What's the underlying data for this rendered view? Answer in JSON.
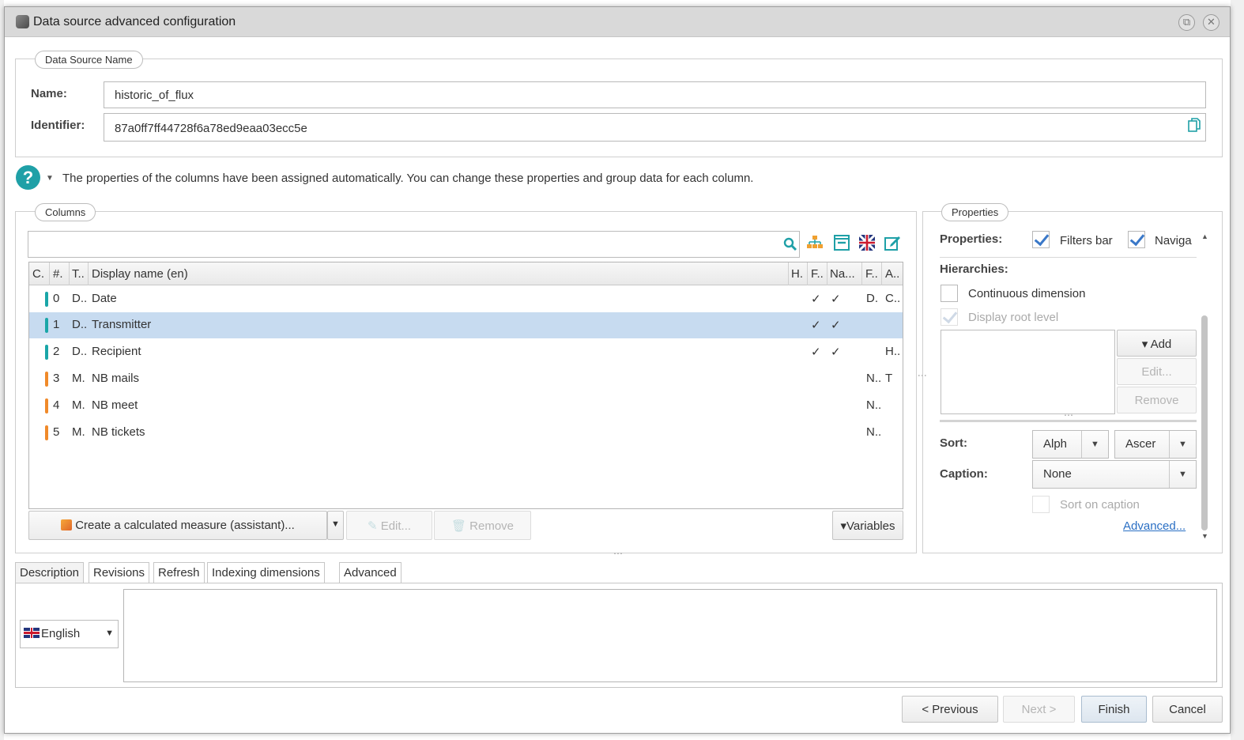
{
  "dialog": {
    "title": "Data source advanced configuration",
    "maximize_glyph": "⧉",
    "close_glyph": "✕"
  },
  "datasource": {
    "legend": "Data Source Name",
    "name_label": "Name:",
    "name_value": "historic_of_flux",
    "identifier_label": "Identifier:",
    "identifier_value": "87a0ff7ff44728f6a78ed9eaa03ecc5e"
  },
  "info": {
    "help_glyph": "?",
    "caret": "▼",
    "text": "The properties of the columns have been assigned automatically. You can change these properties and group data for each column."
  },
  "columns": {
    "legend": "Columns",
    "search_placeholder": "",
    "headers": [
      "C.",
      "#.",
      "T..",
      "Display name (en)",
      "H.",
      "F..",
      "Na...",
      "F..",
      "A.."
    ],
    "rows": [
      {
        "num": "0",
        "type": "D..",
        "name": "Date",
        "f": "✓",
        "na": "✓",
        "f2": "D.",
        "a": "C..",
        "bar_color": "#1aa6a8"
      },
      {
        "num": "1",
        "type": "D..",
        "name": "Transmitter",
        "f": "✓",
        "na": "✓",
        "f2": "",
        "a": "",
        "bar_color": "#1aa6a8"
      },
      {
        "num": "2",
        "type": "D..",
        "name": "Recipient",
        "f": "✓",
        "na": "✓",
        "f2": "",
        "a": "H..",
        "bar_color": "#1aa6a8"
      },
      {
        "num": "3",
        "type": "M.",
        "name": "NB mails",
        "f": "",
        "na": "",
        "f2": "N..",
        "a": "T",
        "bar_color": "#f08a2a"
      },
      {
        "num": "4",
        "type": "M.",
        "name": "NB meet",
        "f": "",
        "na": "",
        "f2": "N..",
        "a": "",
        "bar_color": "#f08a2a"
      },
      {
        "num": "5",
        "type": "M.",
        "name": "NB tickets",
        "f": "",
        "na": "",
        "f2": "N..",
        "a": "",
        "bar_color": "#f08a2a"
      }
    ],
    "selected_row": 1,
    "create_measure_label": "Create a calculated measure (assistant)...",
    "dropdown_caret": "▼",
    "edit_label": "Edit...",
    "remove_label": "Remove",
    "variables_label": "▾Variables"
  },
  "properties": {
    "legend": "Properties",
    "properties_label": "Properties:",
    "filters_bar_label": "Filters bar",
    "filters_bar_checked": true,
    "navigation_label": "Naviga",
    "navigation_checked": true,
    "hierarchies_label": "Hierarchies:",
    "continuous_label": "Continuous dimension",
    "continuous_checked": false,
    "display_root_label": "Display root level",
    "display_root_checked": true,
    "add_label": "▾ Add",
    "edit_label": "Edit...",
    "remove_label": "Remove",
    "sort_label": "Sort:",
    "sort_by_value": "Alph",
    "sort_order_value": "Ascer",
    "caption_label": "Caption:",
    "caption_value": "None",
    "sort_on_caption_label": "Sort on caption",
    "advanced_link": "Advanced..."
  },
  "tabs": [
    "Description",
    "Revisions",
    "Refresh",
    "Indexing dimensions",
    "Advanced"
  ],
  "active_tab": 0,
  "language": {
    "value": "English"
  },
  "footer": {
    "previous_label": "< Previous",
    "next_label": "Next >",
    "finish_label": "Finish",
    "cancel_label": "Cancel"
  },
  "colors": {
    "accent": "#1fa0a7",
    "dimension": "#1aa6a8",
    "measure": "#f08a2a",
    "selection": "#c7dbf0",
    "link": "#2a6fc4"
  }
}
